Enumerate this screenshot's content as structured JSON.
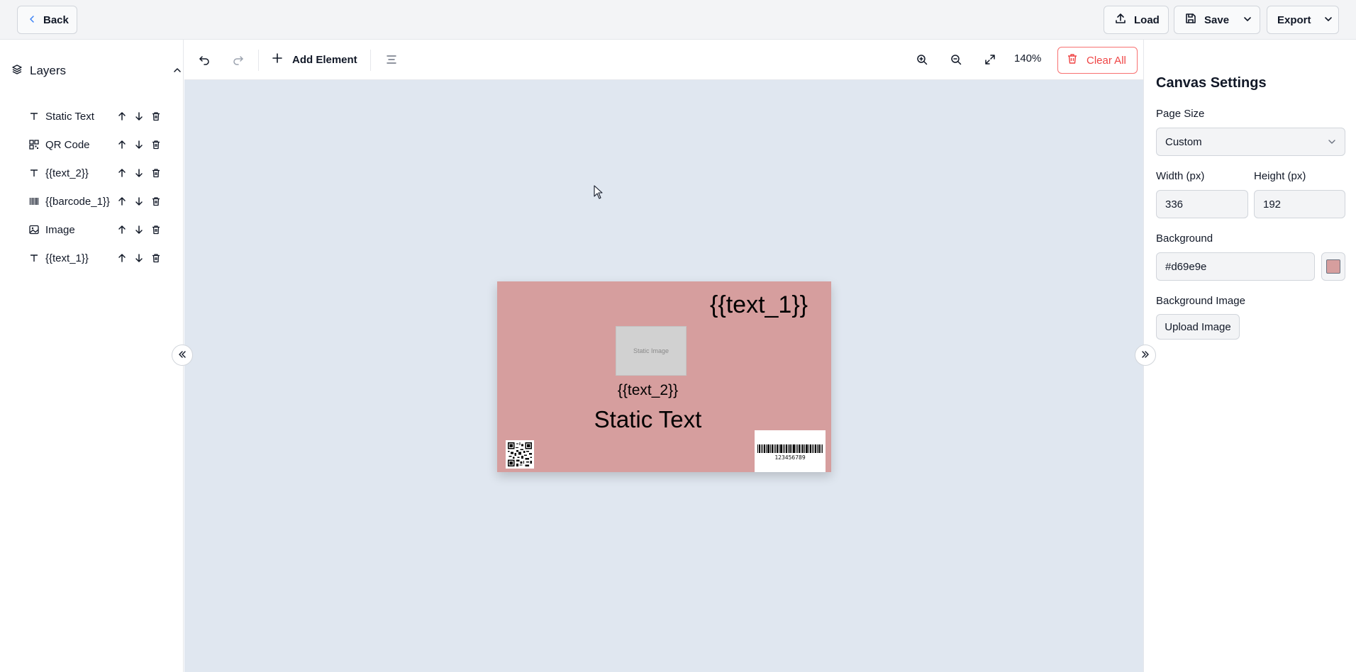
{
  "topbar": {
    "back_label": "Back",
    "load_label": "Load",
    "save_label": "Save",
    "export_label": "Export"
  },
  "layers": {
    "title": "Layers",
    "items": [
      {
        "label": "Static Text",
        "type": "text-icon"
      },
      {
        "label": "QR Code",
        "type": "qr-icon"
      },
      {
        "label": "{{text_2}}",
        "type": "text-icon"
      },
      {
        "label": "{{barcode_1}}",
        "type": "barcode-icon"
      },
      {
        "label": "Image",
        "type": "image-icon"
      },
      {
        "label": "{{text_1}}",
        "type": "text-icon"
      }
    ]
  },
  "toolbar": {
    "add_element_label": "Add Element",
    "zoom": "140%",
    "clear_all_label": "Clear All"
  },
  "canvas": {
    "background_color": "#d69e9e",
    "text_1": "{{text_1}}",
    "image_placeholder": "Static Image",
    "text_2": "{{text_2}}",
    "static_text": "Static Text",
    "barcode_value": "123456789"
  },
  "settings": {
    "title": "Canvas Settings",
    "page_size_label": "Page Size",
    "page_size_value": "Custom",
    "width_label": "Width (px)",
    "width_value": "336",
    "height_label": "Height (px)",
    "height_value": "192",
    "background_label": "Background",
    "background_value": "#d69e9e",
    "background_image_label": "Background Image",
    "upload_label": "Upload Image"
  },
  "colors": {
    "danger": "#ef4444",
    "workspace": "#e0e7f0"
  }
}
